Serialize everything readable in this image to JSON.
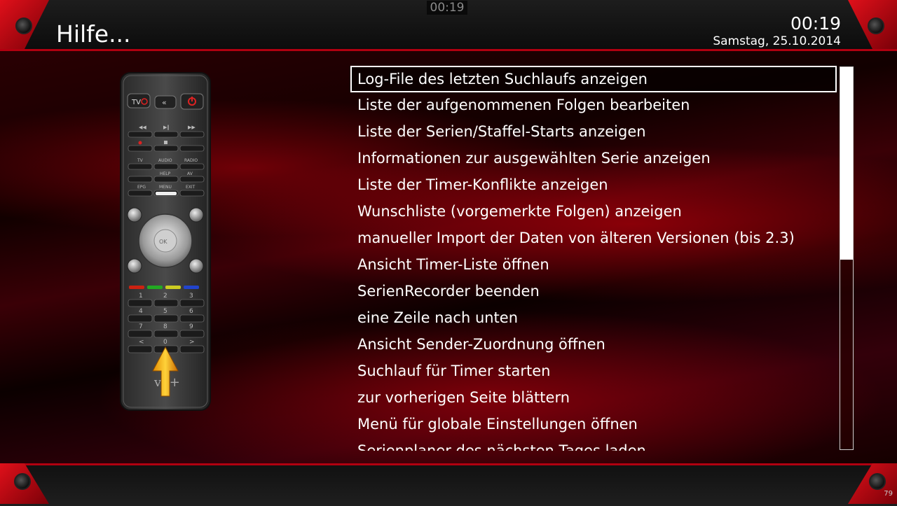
{
  "header": {
    "title": "Hilfe...",
    "top_clock": "00:19",
    "clock": "00:19",
    "date": "Samstag, 25.10.2014"
  },
  "remote": {
    "buttons": {
      "tv": "TV",
      "tv_label": "TV",
      "audio": "AUDIO",
      "radio": "RADIO",
      "help": "HELP",
      "av": "AV",
      "epg": "EPG",
      "menu": "MENU",
      "exit": "EXIT",
      "ok": "OK",
      "n1": "1",
      "n2": "2",
      "n3": "3",
      "n4": "4",
      "n5": "5",
      "n6": "6",
      "n7": "7",
      "n8": "8",
      "n9": "9",
      "n0": "0",
      "prev": "<",
      "next": ">"
    },
    "logo": "vu+",
    "highlighted_key": "down-arrow"
  },
  "help_list": {
    "items": [
      "Log-File des letzten Suchlaufs anzeigen",
      "Liste der aufgenommenen Folgen bearbeiten",
      "Liste der Serien/Staffel-Starts anzeigen",
      "Informationen zur ausgewählten Serie anzeigen",
      "Liste der Timer-Konflikte anzeigen",
      "Wunschliste (vorgemerkte Folgen) anzeigen",
      "manueller Import der Daten von älteren Versionen (bis 2.3)",
      "Ansicht Timer-Liste öffnen",
      "SerienRecorder beenden",
      "eine Zeile nach unten",
      "Ansicht Sender-Zuordnung öffnen",
      "Suchlauf für Timer starten",
      "zur vorherigen Seite blättern",
      "Menü für globale Einstellungen öffnen",
      "Serienplaner des nächsten Tages laden"
    ],
    "selected_index": 0,
    "scroll_fraction": 0.5
  },
  "footer": {
    "page_number": "79"
  },
  "colors": {
    "accent": "#b10010",
    "background": "#000000",
    "selection_border": "#ffffff"
  }
}
